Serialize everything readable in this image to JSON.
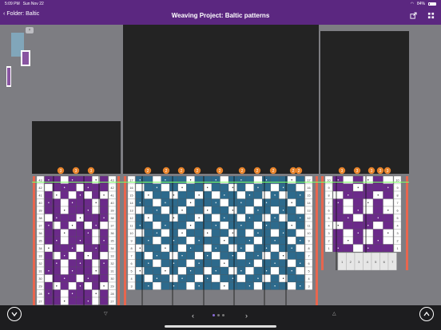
{
  "status": {
    "time": "5:09 PM",
    "date": "Sun Nov 22",
    "battery": "84%"
  },
  "nav": {
    "back_label": "Folder: Baltic",
    "title": "Weaving Project: Baltic patterns"
  },
  "colors": {
    "purple": "#6b2a8a",
    "blue": "#2d6a8c",
    "accent": "#5b2780",
    "highlight": "#e8832a",
    "edge": "#e8664e",
    "rule": "#79ff63"
  },
  "icons": {
    "share": "share-icon",
    "grid": "grid-icon",
    "down": "circle-chevron-down-icon",
    "up": "circle-chevron-up-icon"
  },
  "pager": {
    "prev": "‹",
    "next": "›",
    "pages": 3,
    "current": 1
  },
  "panels": {
    "left": {
      "row_numbers": [
        "43",
        "42",
        "41",
        "40",
        "39",
        "38",
        "37",
        "36",
        "35",
        "34",
        "33",
        "32",
        "31",
        "30",
        "29",
        "28",
        "27"
      ],
      "markers": [
        "3",
        "3",
        "3"
      ]
    },
    "center": {
      "row_numbers": [
        "17",
        "16",
        "15",
        "14",
        "13",
        "12",
        "11",
        "10",
        "9",
        "8",
        "7",
        "6",
        "5",
        "4",
        "3"
      ],
      "markers": [
        "2",
        "2",
        "2",
        "2",
        "2",
        "2",
        "2",
        "2",
        "2",
        "2"
      ]
    },
    "right": {
      "row_numbers": [
        "10",
        "9",
        "8",
        "7",
        "6",
        "5",
        "4",
        "3",
        "2",
        "1"
      ],
      "markers": [
        "3",
        "3",
        "3",
        "3",
        "3"
      ],
      "card_numbers": [
        "1",
        "2",
        "3",
        "4",
        "5",
        "6",
        "7"
      ]
    }
  }
}
